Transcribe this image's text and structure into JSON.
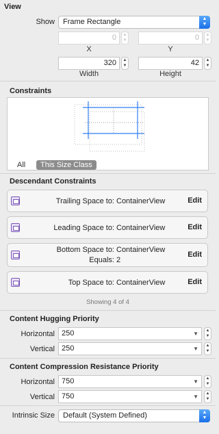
{
  "view": {
    "section_title": "View",
    "show_label": "Show",
    "show_value": "Frame Rectangle",
    "x_value": "0",
    "y_value": "0",
    "x_label": "X",
    "y_label": "Y",
    "width_value": "320",
    "height_value": "42",
    "width_label": "Width",
    "height_label": "Height"
  },
  "constraints": {
    "section_title": "Constraints",
    "tab_all": "All",
    "tab_size_class": "This Size Class"
  },
  "descendant": {
    "section_title": "Descendant Constraints",
    "rows": [
      {
        "name": "Trailing Space to:",
        "target": "ContainerView",
        "extra": "",
        "edit": "Edit"
      },
      {
        "name": "Leading Space to:",
        "target": "ContainerView",
        "extra": "",
        "edit": "Edit"
      },
      {
        "name": "Bottom Space to:",
        "target": "ContainerView",
        "extra": "Equals:",
        "extra_value": "2",
        "edit": "Edit"
      },
      {
        "name": "Top Space to:",
        "target": "ContainerView",
        "extra": "",
        "edit": "Edit"
      }
    ],
    "showing": "Showing 4 of 4"
  },
  "hugging": {
    "section_title": "Content Hugging Priority",
    "horizontal_label": "Horizontal",
    "horizontal_value": "250",
    "vertical_label": "Vertical",
    "vertical_value": "250"
  },
  "compression": {
    "section_title": "Content Compression Resistance Priority",
    "horizontal_label": "Horizontal",
    "horizontal_value": "750",
    "vertical_label": "Vertical",
    "vertical_value": "750"
  },
  "intrinsic": {
    "label": "Intrinsic Size",
    "value": "Default (System Defined)"
  },
  "colors": {
    "accent_blue": "#2f7ef0",
    "constraint_purple": "#7a55b7"
  }
}
